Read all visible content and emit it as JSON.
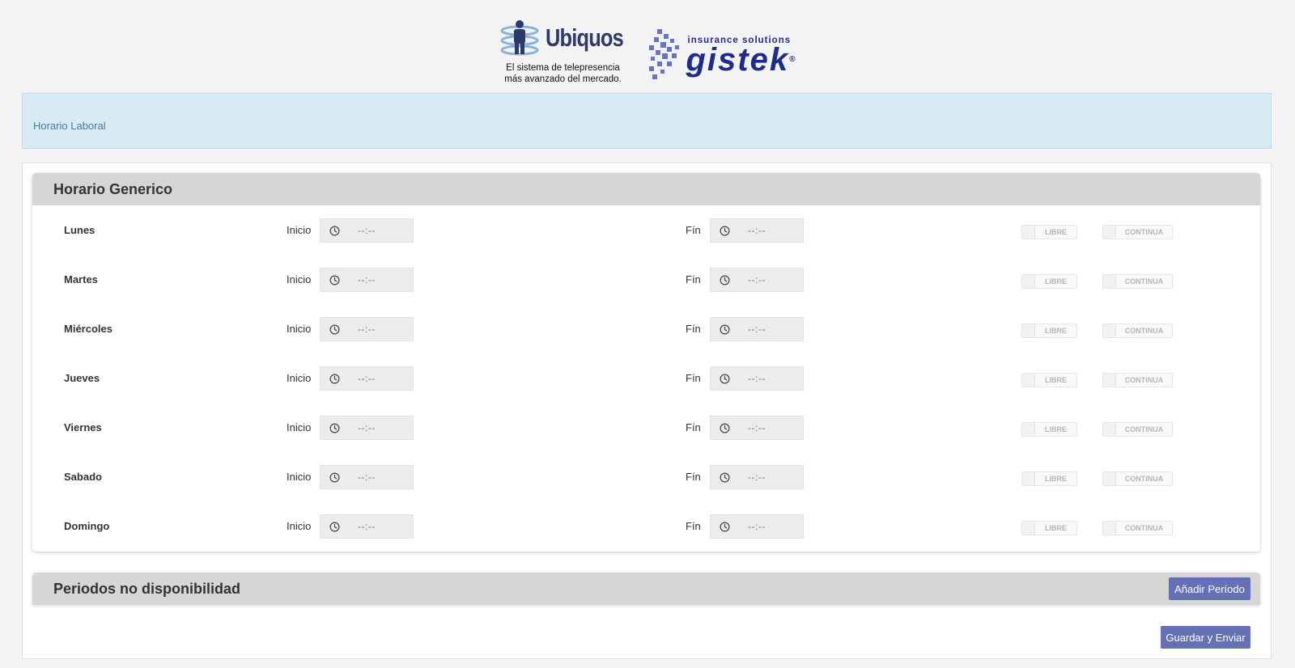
{
  "header": {
    "ubiquos_name": "Ubiquos",
    "ubiquos_tagline_1": "El sistema de telepresencia",
    "ubiquos_tagline_2": "más avanzado del mercado.",
    "gistek_sub": "insurance solutions",
    "gistek_name": "gistek",
    "gistek_mark": "®"
  },
  "alert": {
    "text": "Horario Laboral"
  },
  "schedule": {
    "title": "Horario Generico",
    "start_label": "Inicio",
    "end_label": "Fín",
    "toggle_free_label": "LIBRE",
    "toggle_continuous_label": "CONTINUA",
    "days": [
      {
        "name": "Lunes",
        "start": "--:--",
        "end": "--:--"
      },
      {
        "name": "Martes",
        "start": "--:--",
        "end": "--:--"
      },
      {
        "name": "Miércoles",
        "start": "--:--",
        "end": "--:--"
      },
      {
        "name": "Jueves",
        "start": "--:--",
        "end": "--:--"
      },
      {
        "name": "Viernes",
        "start": "--:--",
        "end": "--:--"
      },
      {
        "name": "Sabado",
        "start": "--:--",
        "end": "--:--"
      },
      {
        "name": "Domingo",
        "start": "--:--",
        "end": "--:--"
      }
    ]
  },
  "periods": {
    "title": "Periodos no disponibilidad",
    "add_button": "Añadir Período"
  },
  "save_button": "Guardar y Enviar",
  "colors": {
    "accent": "#6670b4",
    "alert_bg": "#d9ebf5",
    "header_bg": "#d6d6d6",
    "brand_blue": "#1f2d8a"
  },
  "icons": {
    "time_input": "clock-icon"
  }
}
